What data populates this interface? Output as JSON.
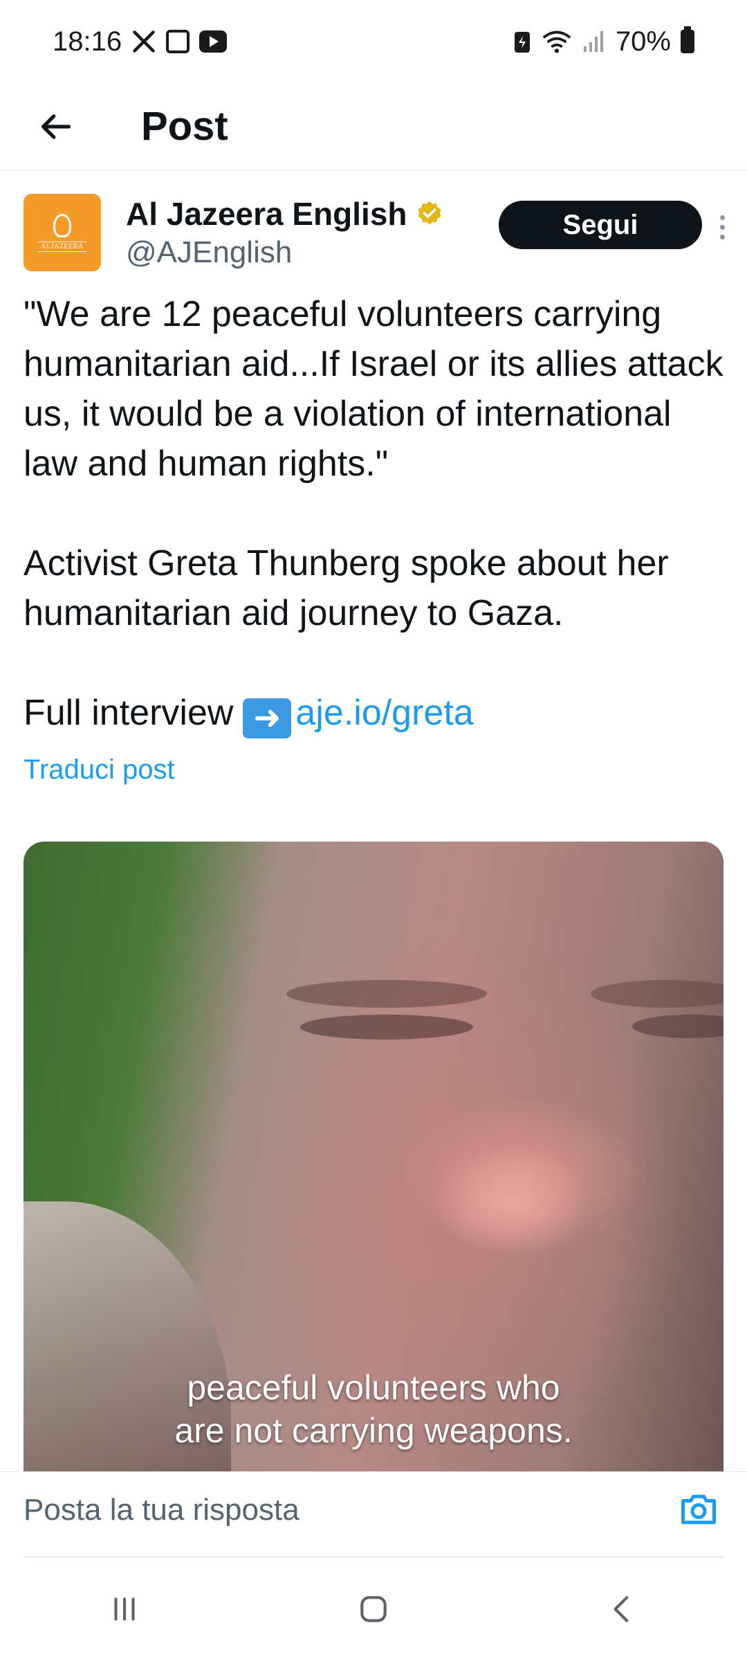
{
  "status_bar": {
    "time": "18:16",
    "battery": "70%",
    "icons": [
      "x-icon",
      "gallery-icon",
      "youtube-icon",
      "battery-saver-icon",
      "wifi-icon",
      "signal-icon",
      "battery-icon"
    ]
  },
  "header": {
    "title": "Post",
    "back_icon": "back-arrow-icon"
  },
  "author": {
    "name": "Al Jazeera English",
    "handle": "@AJEnglish",
    "avatar_text": "ALJAZEERA",
    "follow_label": "Segui",
    "verified_color": "#e2b719"
  },
  "post": {
    "quote": "\"We are 12 peaceful volunteers carrying humanitarian aid...If Israel or its allies attack us, it would be a violation of international law and human rights.\"",
    "body": "Activist Greta Thunberg spoke about her humanitarian aid journey to Gaza.",
    "full_interview": "Full interview",
    "arrow_emoji": "➡️",
    "link": "aje.io/greta",
    "translate": "Traduci post"
  },
  "media": {
    "caption_line1": "peaceful volunteers who",
    "caption_line2": "are not carrying weapons."
  },
  "reply": {
    "placeholder": "Posta la tua risposta"
  },
  "colors": {
    "accent": "#1d9bf0",
    "avatar_bg": "#f39a28",
    "follow_bg": "#0f1419"
  }
}
